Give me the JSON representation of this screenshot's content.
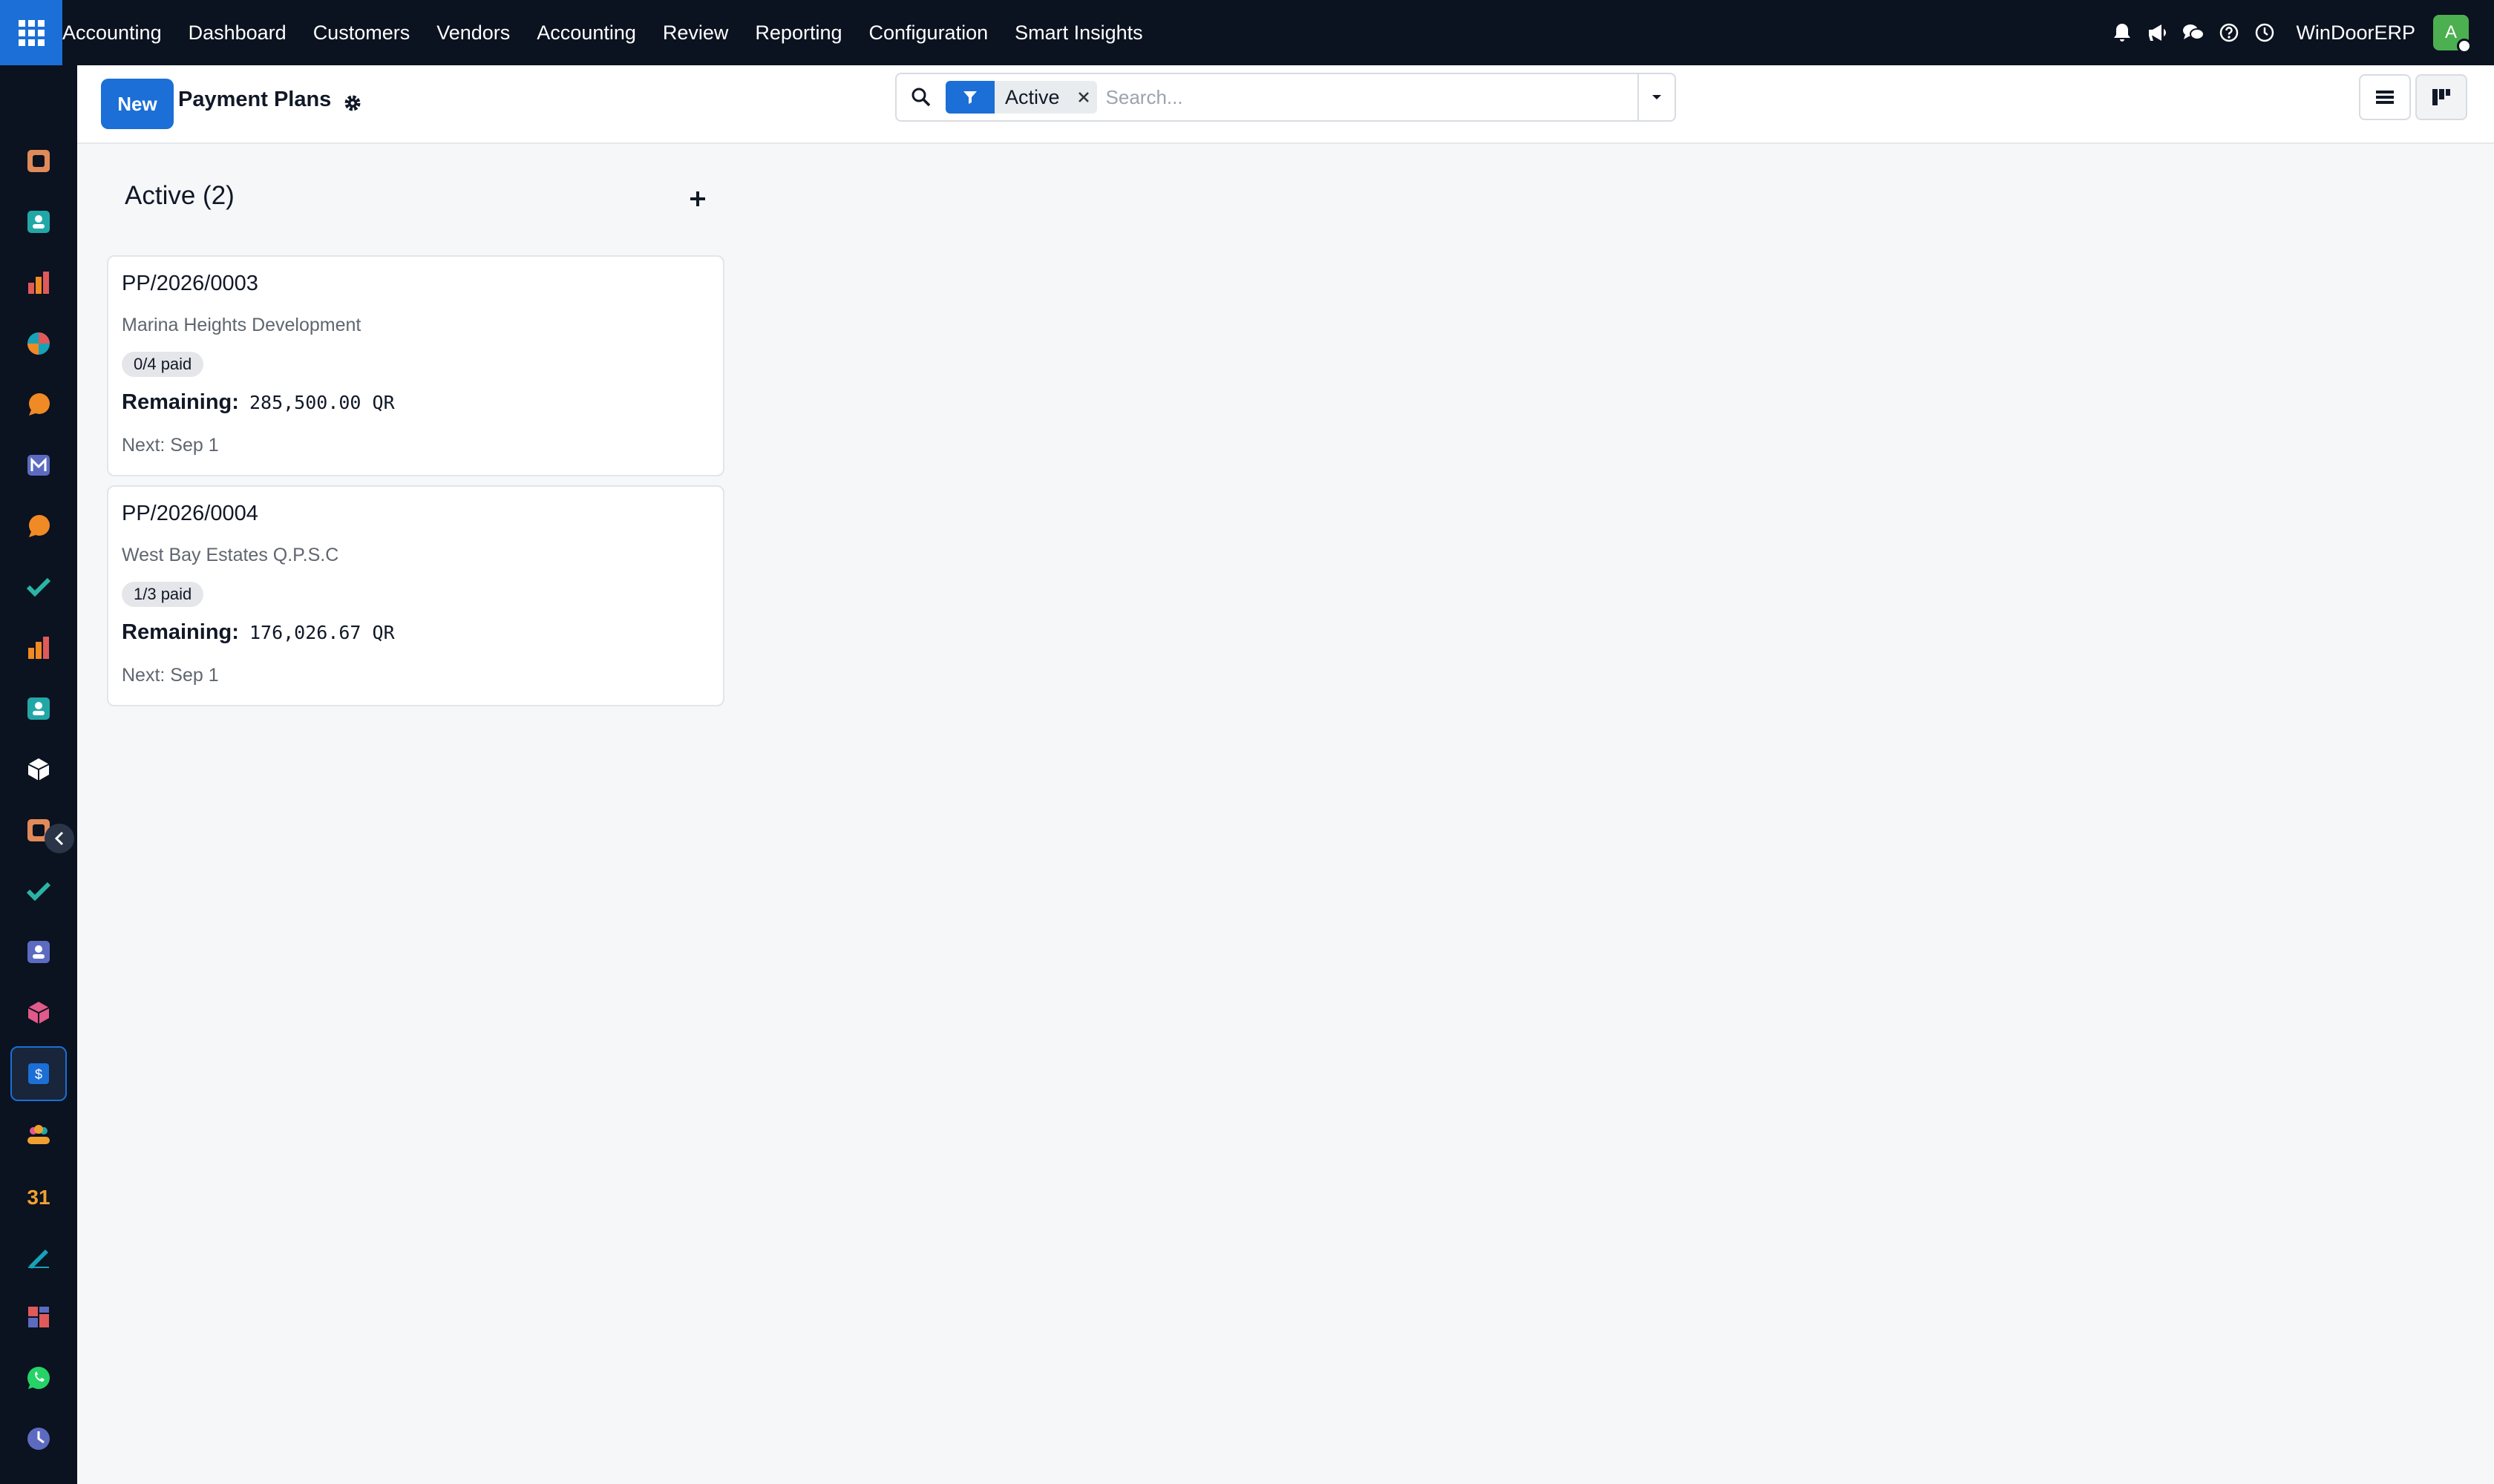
{
  "topbar": {
    "app_name": "Accounting",
    "menu": [
      "Dashboard",
      "Customers",
      "Vendors",
      "Accounting",
      "Review",
      "Reporting",
      "Configuration",
      "Smart Insights"
    ],
    "company": "WinDoorERP",
    "avatar_initial": "A"
  },
  "sidebar": {
    "apps": [
      {
        "icon": "documents-app-icon",
        "color": "#e08a5a"
      },
      {
        "icon": "contacts-app-icon",
        "color": "#22a7a7"
      },
      {
        "icon": "sales-app-icon",
        "color": "#e05a5a"
      },
      {
        "icon": "crm-app-icon",
        "color": "#17a2b8"
      },
      {
        "icon": "discuss-app-icon",
        "color": "#f08a24"
      },
      {
        "icon": "email-marketing-app-icon",
        "color": "#5c6bc0"
      },
      {
        "icon": "live-chat-app-icon",
        "color": "#f08a24"
      },
      {
        "icon": "project-app-icon",
        "color": "#2bb3a3"
      },
      {
        "icon": "reporting-app-icon",
        "color": "#f08a24"
      },
      {
        "icon": "employees-app-icon",
        "color": "#22a7a7"
      },
      {
        "icon": "inventory-app-icon",
        "color": "#ffffff"
      },
      {
        "icon": "knowledge-app-icon",
        "color": "#e08a5a"
      },
      {
        "icon": "todo-app-icon",
        "color": "#2bb3a3"
      },
      {
        "icon": "elearning-app-icon",
        "color": "#5c6bc0"
      },
      {
        "icon": "purchase-app-icon",
        "color": "#e05a8a"
      },
      {
        "icon": "accounting-app-icon",
        "color": "#1b6fd6"
      },
      {
        "icon": "team-app-icon",
        "color": "#f0a030"
      },
      {
        "icon": "calendar-app-icon",
        "color": "#f0a030"
      },
      {
        "icon": "sign-app-icon",
        "color": "#17a2b8"
      },
      {
        "icon": "dashboards-app-icon",
        "color": "#e05a5a"
      },
      {
        "icon": "whatsapp-app-icon",
        "color": "#25d366"
      },
      {
        "icon": "timesheets-app-icon",
        "color": "#5c6bc0"
      },
      {
        "icon": "website-app-icon",
        "color": "#17a2b8"
      }
    ]
  },
  "control": {
    "new_label": "New",
    "title": "Payment Plans",
    "facet_value": "Active",
    "search_placeholder": "Search..."
  },
  "kanban": {
    "column_title": "Active (2)",
    "cards": [
      {
        "ref": "PP/2026/0003",
        "partner": "Marina Heights Development",
        "badge": "0/4 paid",
        "remaining_label": "Remaining:",
        "remaining_amount": "285,500.00 QR",
        "next": "Next: Sep 1"
      },
      {
        "ref": "PP/2026/0004",
        "partner": "West Bay Estates Q.P.S.C",
        "badge": "1/3 paid",
        "remaining_label": "Remaining:",
        "remaining_amount": "176,026.67 QR",
        "next": "Next: Sep 1"
      }
    ]
  },
  "colors": {
    "accent": "#1b6fd6",
    "navbar": "#0b1220",
    "avatar": "#4caf50"
  }
}
